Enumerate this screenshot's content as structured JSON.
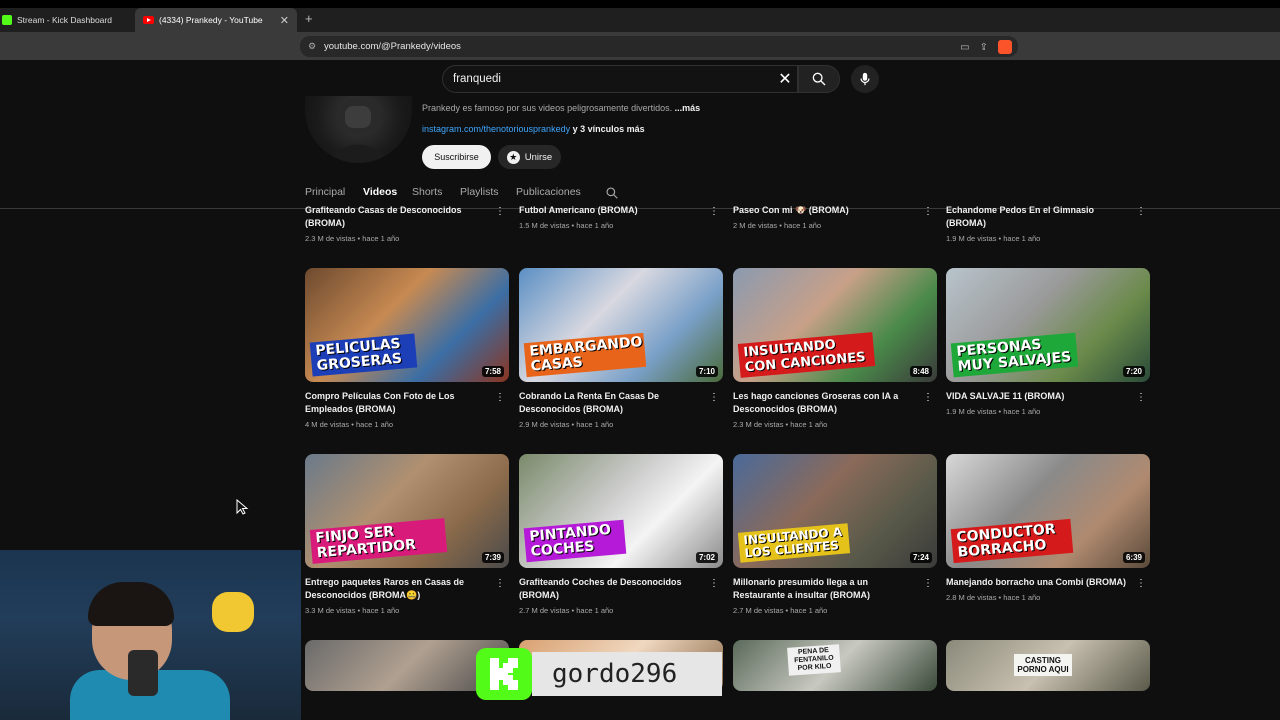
{
  "browser": {
    "tabs": [
      {
        "label": "Stream - Kick Dashboard"
      },
      {
        "label": "(4334) Prankedy - YouTube"
      }
    ],
    "url": "youtube.com/@Prankedy/videos"
  },
  "search": {
    "value": "franquedi"
  },
  "channel": {
    "description": "Prankedy es famoso por sus videos peligrosamente divertidos.",
    "description_more": "...más",
    "link": "instagram.com/thenotoriousprankedy",
    "link_more": "y 3 vínculos más",
    "subscribe_label": "Suscribirse",
    "join_label": "Unirse"
  },
  "nav": {
    "tabs": [
      "Principal",
      "Videos",
      "Shorts",
      "Playlists",
      "Publicaciones"
    ],
    "active": "Videos"
  },
  "videos_row0": [
    {
      "title": "Grafiteando Casas de Desconocidos (BROMA)",
      "meta": "2.3 M de vistas • hace 1 año"
    },
    {
      "title": "Futbol Americano (BROMA)",
      "meta": "1.5 M de vistas • hace 1 año"
    },
    {
      "title": "Paseo Con mi 🐶 (BROMA)",
      "meta": "2 M de vistas • hace 1 año"
    },
    {
      "title": "Echandome Pedos En el Gimnasio (BROMA)",
      "meta": "1.9 M de vistas • hace 1 año"
    }
  ],
  "videos_row1": [
    {
      "title": "Compro Películas Con Foto de Los Empleados (BROMA)",
      "meta": "4 M de vistas • hace 1 año",
      "duration": "7:58",
      "overlay": "PELICULAS GROSERAS"
    },
    {
      "title": "Cobrando La Renta En Casas De Desconocidos (BROMA)",
      "meta": "2.9 M de vistas • hace 1 año",
      "duration": "7:10",
      "overlay": "EMBARGANDO CASAS"
    },
    {
      "title": "Les hago canciones Groseras con IA a Desconocidos (BROMA)",
      "meta": "2.3 M de vistas • hace 1 año",
      "duration": "8:48",
      "overlay": "INSULTANDO CON CANCIONES"
    },
    {
      "title": "VIDA SALVAJE 11 (BROMA)",
      "meta": "1.9 M de vistas • hace 1 año",
      "duration": "7:20",
      "overlay": "PERSONAS MUY SALVAJES"
    }
  ],
  "videos_row2": [
    {
      "title": "Entrego paquetes Raros en Casas de Desconocidos (BROMA🤐)",
      "meta": "3.3 M de vistas • hace 1 año",
      "duration": "7:39",
      "overlay": "FINJO SER REPARTIDOR"
    },
    {
      "title": "Grafiteando Coches de Desconocidos (BROMA)",
      "meta": "2.7 M de vistas • hace 1 año",
      "duration": "7:02",
      "overlay": "PINTANDO COCHES"
    },
    {
      "title": "Millonario presumido llega a un Restaurante a insultar (BROMA)",
      "meta": "2.7 M de vistas • hace 1 año",
      "duration": "7:24",
      "overlay": "INSULTANDO A LOS CLIENTES"
    },
    {
      "title": "Manejando borracho una Combi (BROMA)",
      "meta": "2.8 M de vistas • hace 1 año",
      "duration": "6:39",
      "overlay": "CONDUCTOR BORRACHO"
    }
  ],
  "thumb_signs": [
    "PENA DE FENTANILO POR KILO",
    "CASTING PORNO AQUI"
  ],
  "stream_overlay": {
    "username": "gordo296"
  },
  "colors": {
    "kick_green": "#53fc18",
    "yt_bg": "#0f0f0f",
    "link_blue": "#3ea6ff"
  }
}
